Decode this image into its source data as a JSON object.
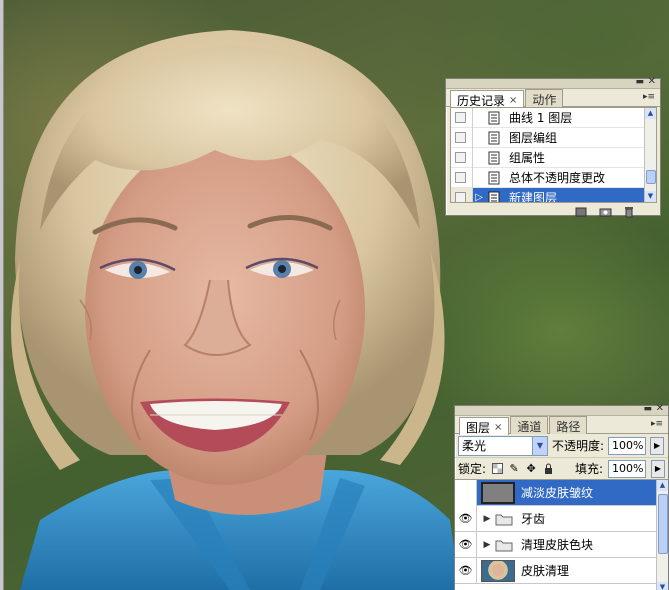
{
  "history_panel": {
    "tabs": [
      {
        "label": "历史记录",
        "active": true
      },
      {
        "label": "动作",
        "active": false
      }
    ],
    "items": [
      {
        "label": "曲线 1 图层"
      },
      {
        "label": "图层编组"
      },
      {
        "label": "组属性"
      },
      {
        "label": "总体不透明度更改"
      },
      {
        "label": "新建图层",
        "selected": true
      }
    ],
    "footer_icons": [
      "new-document-icon",
      "snapshot-icon",
      "trash-icon"
    ]
  },
  "layers_panel": {
    "tabs": [
      {
        "label": "图层",
        "active": true
      },
      {
        "label": "通道",
        "active": false
      },
      {
        "label": "路径",
        "active": false
      }
    ],
    "blend_mode": "柔光",
    "opacity_label": "不透明度:",
    "opacity_value": "100%",
    "lock_label": "锁定:",
    "fill_label": "填充:",
    "fill_value": "100%",
    "layers": [
      {
        "name": "减淡皮肤皱纹",
        "type": "layer",
        "visible": true,
        "selected": true,
        "thumb_color": "#808080"
      },
      {
        "name": "牙齿",
        "type": "group",
        "visible": true,
        "selected": false
      },
      {
        "name": "清理皮肤色块",
        "type": "group",
        "visible": true,
        "selected": false
      },
      {
        "name": "皮肤清理",
        "type": "layer",
        "visible": true,
        "selected": false,
        "thumb_color": "photo"
      }
    ]
  },
  "colors": {
    "selection": "#316ac5",
    "panel_bg": "#ece9d8",
    "shirt": "#2f8fcb"
  }
}
